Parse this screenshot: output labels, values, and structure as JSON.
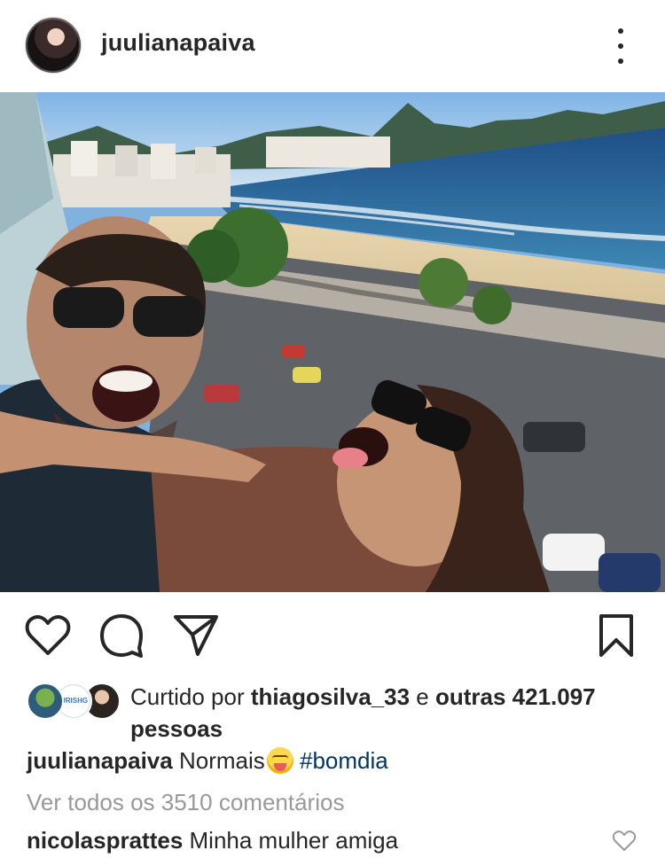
{
  "post": {
    "username": "juulianapaiva",
    "header_avatar_icon": "profile-avatar",
    "more_icon": "more-vertical-icon"
  },
  "photo": {
    "content": "selfie-on-balcony-over-beach"
  },
  "actions": {
    "like_icon": "heart-icon",
    "comment_icon": "comment-icon",
    "share_icon": "send-icon",
    "save_icon": "bookmark-icon"
  },
  "likes": {
    "prefix": "Curtido por ",
    "liker": "thiagosilva_33",
    "joiner": " e ",
    "others": "outras 421.097 pessoas",
    "avatar_b_label": "URISHG"
  },
  "caption": {
    "username": "juulianapaiva",
    "text": " Normais",
    "emoji": "squinting-face-with-tongue",
    "hashtag": "#bomdia"
  },
  "comments": {
    "view_all": "Ver todos os 3510 comentários",
    "first": {
      "username": "nicolasprattes",
      "text": " Minha mulher amiga"
    }
  },
  "colors": {
    "text": "#262626",
    "muted": "#999999",
    "hashtag": "#003569"
  }
}
